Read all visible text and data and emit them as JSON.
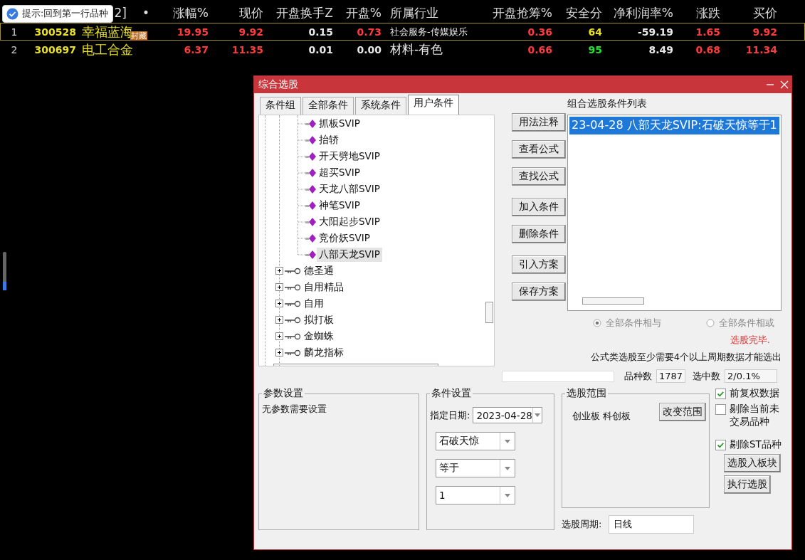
{
  "tooltip": {
    "text": "提示:回到第一行品种"
  },
  "table": {
    "header_fragments": [
      "2]",
      "•"
    ],
    "columns": [
      "涨幅%",
      "现价",
      "开盘换手Z",
      "开盘%",
      "所属行业",
      "开盘抢筹%",
      "安全分",
      "净利润率%",
      "涨跌",
      "买价"
    ],
    "rows": [
      {
        "index": "1",
        "code": "300528",
        "name": "幸福蓝海",
        "badge": "封藏",
        "selected": true,
        "cells": [
          {
            "text": "19.95",
            "color": "#ff3b3b"
          },
          {
            "text": "9.92",
            "color": "#ff3b3b"
          },
          {
            "text": "0.15",
            "color": "#e8e8e8"
          },
          {
            "text": "0.73",
            "color": "#ff3b3b"
          },
          {
            "text": "社会服务-传媒娱乐",
            "color": "#e8e8e8"
          },
          {
            "text": "0.36",
            "color": "#ff3b3b"
          },
          {
            "text": "64",
            "color": "#e8e020"
          },
          {
            "text": "-59.19",
            "color": "#e8e8e8"
          },
          {
            "text": "1.65",
            "color": "#ff3b3b"
          },
          {
            "text": "9.92",
            "color": "#ff3b3b"
          }
        ]
      },
      {
        "index": "2",
        "code": "300697",
        "name": "电工合金",
        "selected": false,
        "cells": [
          {
            "text": "6.37",
            "color": "#ff3b3b"
          },
          {
            "text": "11.35",
            "color": "#ff3b3b"
          },
          {
            "text": "0.01",
            "color": "#e8e8e8"
          },
          {
            "text": "0.00",
            "color": "#e8e8e8"
          },
          {
            "text": "材料-有色",
            "color": "#e8e8e8"
          },
          {
            "text": "0.66",
            "color": "#ff3b3b"
          },
          {
            "text": "95",
            "color": "#20e030"
          },
          {
            "text": "8.49",
            "color": "#e8e8e8"
          },
          {
            "text": "0.68",
            "color": "#ff3b3b"
          },
          {
            "text": "11.34",
            "color": "#ff3b3b"
          }
        ]
      }
    ]
  },
  "dialog": {
    "title": "综合选股",
    "tabs": [
      {
        "label": "条件组",
        "selected": false
      },
      {
        "label": "全部条件",
        "selected": false
      },
      {
        "label": "系统条件",
        "selected": false
      },
      {
        "label": "用户条件",
        "selected": true
      }
    ],
    "tree": [
      {
        "kind": "formula",
        "label": "抓板SVIP",
        "selected": false
      },
      {
        "kind": "formula",
        "label": "抬轿",
        "selected": false
      },
      {
        "kind": "formula",
        "label": "开天劈地SVIP",
        "selected": false
      },
      {
        "kind": "formula",
        "label": "超买SVIP",
        "selected": false
      },
      {
        "kind": "formula",
        "label": "天龙八部SVIP",
        "selected": false
      },
      {
        "kind": "formula",
        "label": "神笔SVIP",
        "selected": false
      },
      {
        "kind": "formula",
        "label": "大阳起步SVIP",
        "selected": false
      },
      {
        "kind": "formula",
        "label": "竞价妖SVIP",
        "selected": false
      },
      {
        "kind": "formula",
        "label": "八部天龙SVIP",
        "selected": true
      },
      {
        "kind": "group",
        "label": "德圣通",
        "expanded": false
      },
      {
        "kind": "group",
        "label": "自用精品",
        "expanded": false
      },
      {
        "kind": "group",
        "label": "自用",
        "expanded": false
      },
      {
        "kind": "group",
        "label": "拟打板",
        "expanded": false
      },
      {
        "kind": "group",
        "label": "金蜘蛛",
        "expanded": false
      },
      {
        "kind": "group",
        "label": "麟龙指标",
        "expanded": false
      }
    ],
    "buttons": [
      [
        "用法注释",
        "查看公式",
        "查找公式"
      ],
      [
        "加入条件",
        "删除条件"
      ],
      [
        "引入方案",
        "保存方案"
      ]
    ],
    "condition_list": {
      "label": "组合选股条件列表",
      "items": [
        {
          "text": "23-04-28 八部天龙SVIP:石破天惊等于1",
          "selected": true
        }
      ]
    },
    "logic": [
      {
        "label": "全部条件相与",
        "selected": true
      },
      {
        "label": "全部条件相或",
        "selected": false
      }
    ],
    "status": "选股完毕.",
    "note": "公式类选股至少需要4个以上周期数据才能选出",
    "count_label": "品种数",
    "count": "1787",
    "selected_label": "选中数",
    "selected_count": "2/0.1%",
    "params": {
      "title": "参数设置",
      "text": "无参数需要设置"
    },
    "conditions": {
      "title": "条件设置",
      "date_label": "指定日期:",
      "date": "2023-04-28",
      "selects": [
        "石破天惊",
        "等于",
        "1"
      ]
    },
    "scope": {
      "title": "选股范围",
      "text": "创业板 科创板",
      "button": "改变范围"
    },
    "options": [
      {
        "label": "前复权数据",
        "checked": true
      },
      {
        "label": "剔除当前未交易品种",
        "checked": false
      },
      {
        "label": "剔除ST品种",
        "checked": true
      }
    ],
    "action_buttons": [
      "选股入板块",
      "执行选股"
    ],
    "period": {
      "label": "选股周期:",
      "value": "日线"
    }
  }
}
